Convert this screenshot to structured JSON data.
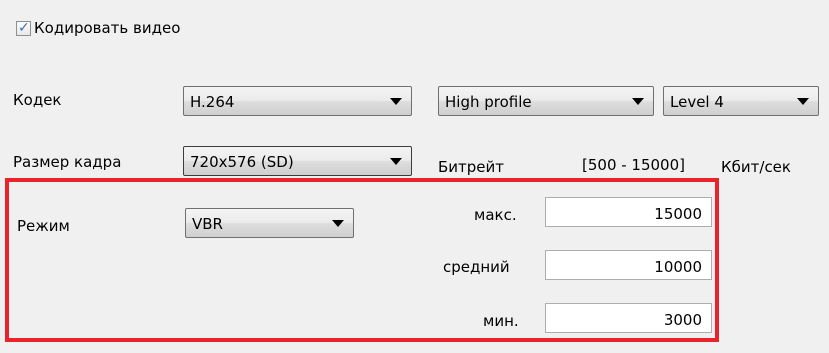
{
  "encode_video": {
    "label": "Кодировать видео",
    "checked": true
  },
  "codec": {
    "label": "Кодек",
    "value": "H.264"
  },
  "profile": {
    "value": "High profile"
  },
  "level": {
    "value": "Level 4"
  },
  "frame_size": {
    "label": "Размер кадра",
    "value": "720x576 (SD)"
  },
  "bitrate": {
    "label": "Битрейт",
    "range": "[500 - 15000]",
    "unit": "Кбит/сек"
  },
  "mode": {
    "label": "Режим",
    "value": "VBR"
  },
  "bitrate_max": {
    "label": "макс.",
    "value": "15000"
  },
  "bitrate_avg": {
    "label": "средний",
    "value": "10000"
  },
  "bitrate_min": {
    "label": "мин.",
    "value": "3000"
  },
  "colors": {
    "highlight_border": "#e8232b",
    "background": "#f0f0f0"
  }
}
